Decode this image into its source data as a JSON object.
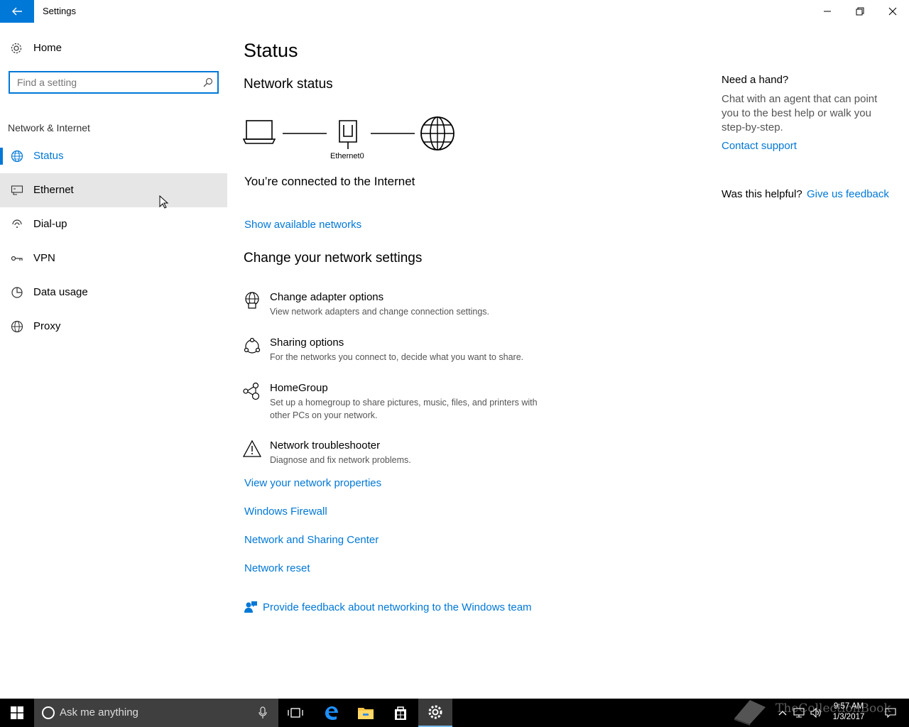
{
  "window": {
    "title": "Settings",
    "back_icon": "arrow-left-icon",
    "controls": [
      "minimize",
      "maximize",
      "close"
    ]
  },
  "sidebar": {
    "home_label": "Home",
    "search_placeholder": "Find a setting",
    "section_header": "Network & Internet",
    "items": [
      {
        "label": "Status",
        "icon": "globe-icon",
        "state": "active"
      },
      {
        "label": "Ethernet",
        "icon": "ethernet-icon",
        "state": "hover"
      },
      {
        "label": "Dial-up",
        "icon": "dialup-icon",
        "state": "normal"
      },
      {
        "label": "VPN",
        "icon": "vpn-icon",
        "state": "normal"
      },
      {
        "label": "Data usage",
        "icon": "data-usage-icon",
        "state": "normal"
      },
      {
        "label": "Proxy",
        "icon": "proxy-globe-icon",
        "state": "normal"
      }
    ]
  },
  "main": {
    "title": "Status",
    "network_status_heading": "Network status",
    "diagram": {
      "adapter_label": "Ethernet0"
    },
    "connected_text": "You’re connected to the Internet",
    "show_networks_link": "Show available networks",
    "change_heading": "Change your network settings",
    "options": [
      {
        "title": "Change adapter options",
        "desc": "View network adapters and change connection settings.",
        "icon": "adapter-globe-icon"
      },
      {
        "title": "Sharing options",
        "desc": "For the networks you connect to, decide what you want to share.",
        "icon": "sharing-icon"
      },
      {
        "title": "HomeGroup",
        "desc": "Set up a homegroup to share pictures, music, files, and printers with other PCs on your network.",
        "icon": "homegroup-icon"
      },
      {
        "title": "Network troubleshooter",
        "desc": "Diagnose and fix network problems.",
        "icon": "warning-icon"
      }
    ],
    "links": [
      "View your network properties",
      "Windows Firewall",
      "Network and Sharing Center",
      "Network reset"
    ],
    "feedback_link": "Provide feedback about networking to the Windows team"
  },
  "right_panel": {
    "need_hand": "Need a hand?",
    "chat_text": "Chat with an agent that can point you to the best help or walk you step-by-step.",
    "contact_link": "Contact support",
    "helpful_text": "Was this helpful?",
    "feedback_link": "Give us feedback"
  },
  "taskbar": {
    "search_placeholder": "Ask me anything",
    "time": "9:57 AM",
    "date": "1/3/2017",
    "watermark": "TheCollectionBook"
  },
  "colors": {
    "accent": "#0078d7",
    "hover_bg": "#e6e6e6",
    "taskbar_bg": "#000000"
  }
}
